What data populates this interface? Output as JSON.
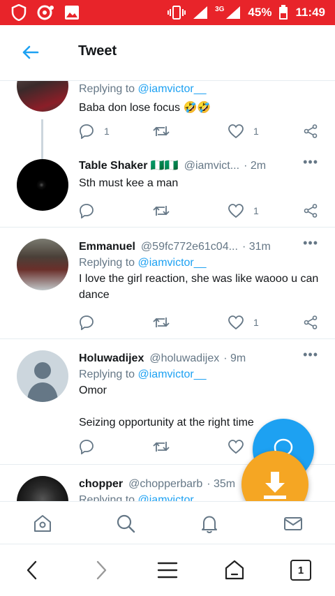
{
  "status_bar": {
    "network": "3G",
    "battery": "45%",
    "time": "11:49"
  },
  "header": {
    "title": "Tweet"
  },
  "tweets": [
    {
      "display_name": "",
      "handle": "",
      "time": "",
      "replying_prefix": "Replying to",
      "replying_to": "@iamvictor__",
      "text": "Baba don lose focus 🤣🤣",
      "reply_count": "1",
      "like_count": "1"
    },
    {
      "display_name": "Table Shaker 🇳🇬🇳🇬",
      "handle": "@iamvict...",
      "time": "· 2m",
      "replying_prefix": "",
      "replying_to": "",
      "text": "Sth must kee a man",
      "reply_count": "",
      "like_count": "1"
    },
    {
      "display_name": "Emmanuel",
      "handle": "@59fc772e61c04...",
      "time": "· 31m",
      "replying_prefix": "Replying to",
      "replying_to": "@iamvictor__",
      "text": "I love the girl reaction, she was like waooo u can dance",
      "reply_count": "",
      "like_count": "1"
    },
    {
      "display_name": "Holuwadijex",
      "handle": "@holuwadijex",
      "time": "· 9m",
      "replying_prefix": "Replying to",
      "replying_to": "@iamvictor__",
      "text": "Omor",
      "text2": "Seizing opportunity at the right time",
      "reply_count": "",
      "like_count": ""
    },
    {
      "display_name": "chopper",
      "handle": "@chopperbarb",
      "time": "· 35m",
      "replying_prefix": "Replying to",
      "replying_to": "@iamvictor"
    }
  ],
  "colors": {
    "status_bar": "#e8242a",
    "accent": "#1da1f2",
    "download_fab": "#f5a623",
    "muted": "#657786"
  },
  "icons": {
    "tabs": [
      "home-icon",
      "search-icon",
      "notifications-icon",
      "messages-icon"
    ],
    "nav": [
      "back-chevron-icon",
      "forward-chevron-icon",
      "menu-icon",
      "home-icon",
      "tabs-icon"
    ],
    "tabs_count": "1"
  }
}
